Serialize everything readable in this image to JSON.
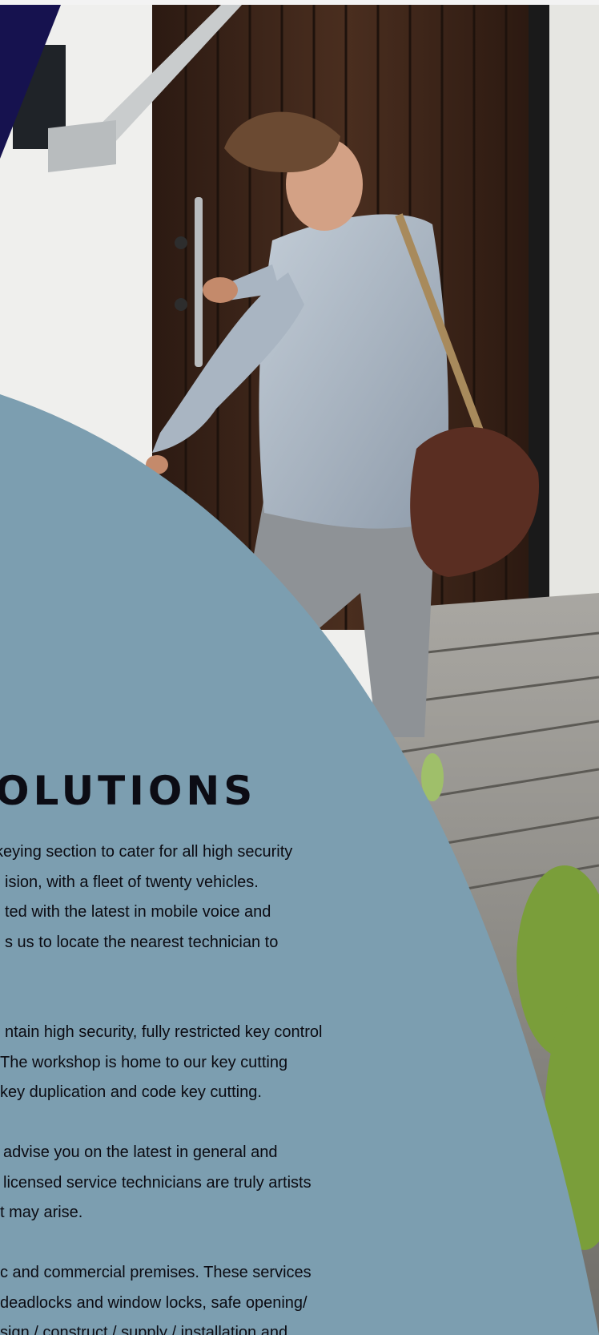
{
  "heading": "OLUTIONS",
  "paragraphs": [
    {
      "lines": [
        "keying section to cater for all high security",
        "ision, with a fleet of twenty vehicles.",
        "ted with the latest in mobile voice and",
        "s us to locate the nearest technician to"
      ]
    },
    {
      "lines": [
        "ntain high security, fully restricted key control",
        "The workshop is home to our key cutting",
        "key duplication and code key cutting."
      ]
    },
    {
      "lines": [
        "advise you on the latest in general and",
        "licensed service technicians are truly artists",
        "t may arise."
      ]
    },
    {
      "lines": [
        "c and commercial premises.  These services",
        "deadlocks and window locks, safe opening/",
        "sign / construct / supply / installation and"
      ]
    }
  ],
  "colors": {
    "navy_corner": "#16124f",
    "blue_panel": "#7c9eb0",
    "door_wood": "#3a2418",
    "wall": "#eeeeec",
    "deck": "#8d8b86",
    "text": "#0b0b12"
  }
}
